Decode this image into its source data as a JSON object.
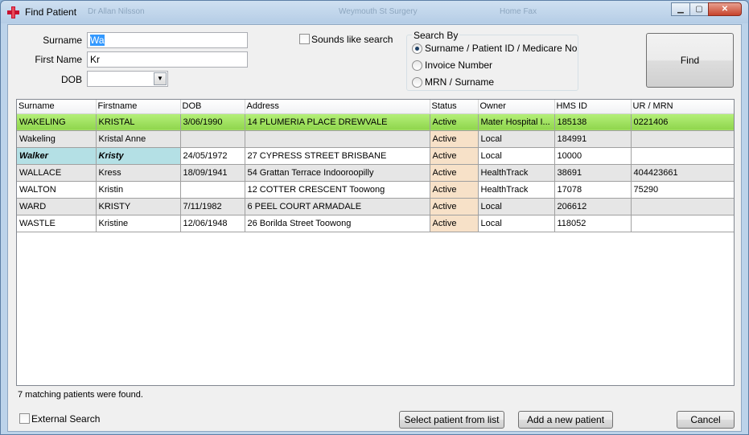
{
  "window": {
    "title": "Find Patient",
    "ghost_texts": [
      "Dr Allan Nilsson",
      "Weymouth St Surgery",
      "Home Fax"
    ]
  },
  "form": {
    "surname_label": "Surname",
    "surname_value": "Wa",
    "firstname_label": "First Name",
    "firstname_value": "Kr",
    "dob_label": "DOB",
    "dob_value": "",
    "sounds_like_label": "Sounds like search",
    "sounds_like_checked": false
  },
  "search_by": {
    "title": "Search By",
    "options": [
      {
        "label": "Surname / Patient ID / Medicare No",
        "selected": true
      },
      {
        "label": "Invoice Number",
        "selected": false
      },
      {
        "label": "MRN / Surname",
        "selected": false
      }
    ]
  },
  "buttons": {
    "find": "Find",
    "select_patient": "Select patient from list",
    "add_patient": "Add a new patient",
    "cancel": "Cancel"
  },
  "grid": {
    "columns": [
      "Surname",
      "Firstname",
      "DOB",
      "Address",
      "Status",
      "Owner",
      "HMS ID",
      "UR / MRN"
    ],
    "rows": [
      [
        "WAKELING",
        "KRISTAL",
        "3/06/1990",
        "14 PLUMERIA PLACE   DREWVALE",
        "Active",
        "Mater Hospital I...",
        "185138",
        "0221406"
      ],
      [
        "Wakeling",
        "Kristal Anne",
        "",
        "",
        "Active",
        "Local",
        "184991",
        ""
      ],
      [
        "Walker",
        "Kristy",
        "24/05/1972",
        "27 CYPRESS STREET  BRISBANE",
        "Active",
        "Local",
        "10000",
        ""
      ],
      [
        "WALLACE",
        "Kress",
        "18/09/1941",
        "54 Grattan Terrace  Indooroopilly",
        "Active",
        "HealthTrack",
        "38691",
        "404423661"
      ],
      [
        "WALTON",
        "Kristin",
        "",
        "12 COTTER CRESCENT  Toowong",
        "Active",
        "HealthTrack",
        "17078",
        "75290"
      ],
      [
        "WARD",
        "KRISTY",
        "7/11/1982",
        "6 PEEL COURT  ARMADALE",
        "Active",
        "Local",
        "206612",
        ""
      ],
      [
        "WASTLE",
        "Kristine",
        "12/06/1948",
        "26 Borilda Street  Toowong",
        "Active",
        "Local",
        "118052",
        ""
      ]
    ]
  },
  "status": {
    "message": "7 matching patients were found."
  },
  "external_search": {
    "label": "External Search",
    "checked": false
  },
  "colors": {
    "selected_row": "#8fd54c",
    "status_cell": "#f7e1c8",
    "highlight_name": "#b4e0e5"
  }
}
